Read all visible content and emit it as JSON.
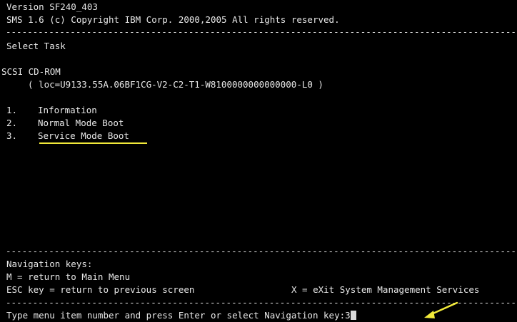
{
  "header": {
    "version": "Version SF240_403",
    "copyright": "SMS 1.6 (c) Copyright IBM Corp. 2000,2005 All rights reserved."
  },
  "separator": "--------------------------------------------------------------------------------------------------------------",
  "task_title": "Select Task",
  "device": {
    "name": "SCSI CD-ROM",
    "location": "( loc=U9133.55A.06BF1CG-V2-C2-T1-W8100000000000000-L0 )"
  },
  "menu": [
    {
      "num": "1.",
      "label": "Information"
    },
    {
      "num": "2.",
      "label": "Normal Mode Boot"
    },
    {
      "num": "3.",
      "label": "Service Mode Boot"
    }
  ],
  "navigation": {
    "title": "Navigation keys:",
    "main_menu": "M = return to Main Menu",
    "esc": "ESC key = return to previous screen",
    "exit": "X = eXit System Management Services"
  },
  "prompt": {
    "text": "Type menu item number and press Enter or select Navigation key:",
    "value": "3"
  },
  "colors": {
    "background": "#000000",
    "text": "#e8e8e8",
    "annotation": "#f2ea3a"
  }
}
